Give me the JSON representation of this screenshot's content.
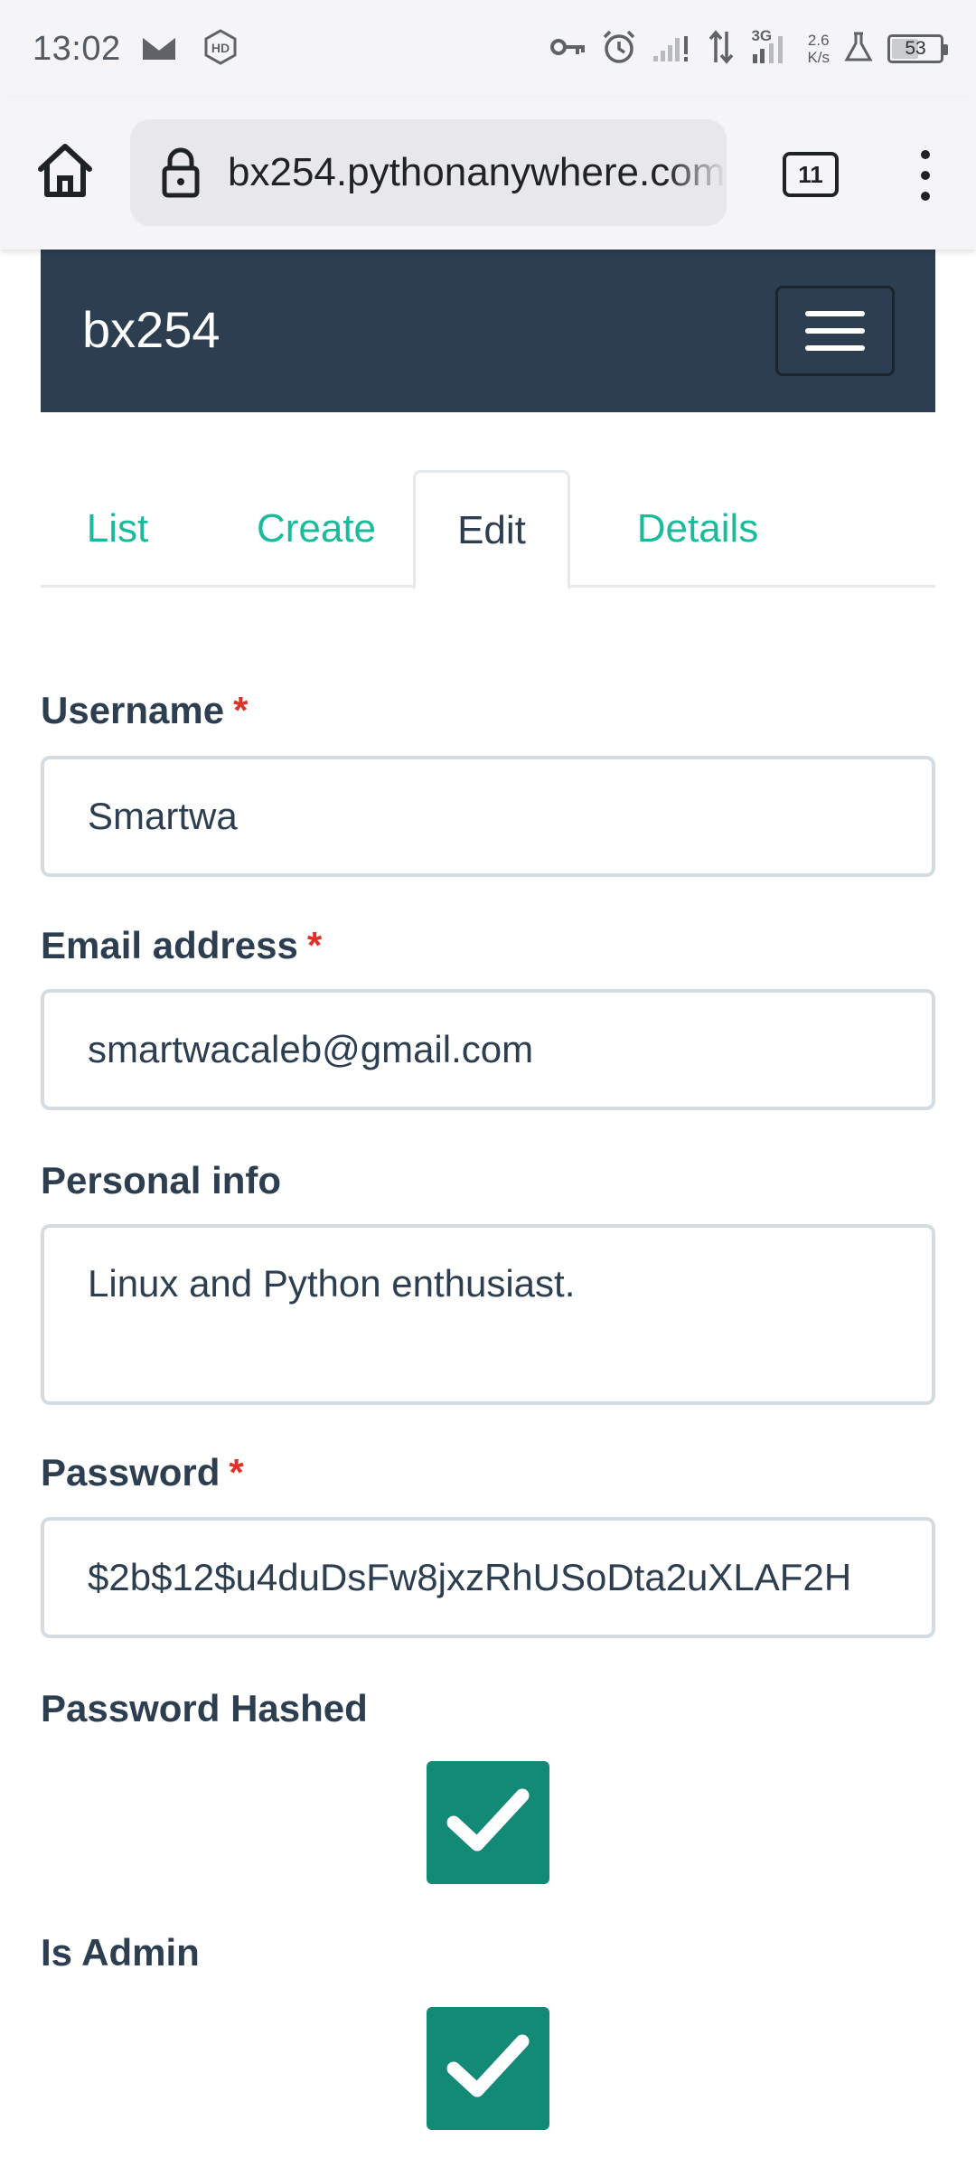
{
  "status_bar": {
    "time": "13:02",
    "speed_value": "2.6",
    "speed_unit": "K/s",
    "network_label": "3G",
    "battery": "53",
    "battery_level_percent": 53
  },
  "browser": {
    "url": "bx254.pythonanywhere.com",
    "tab_count": "11"
  },
  "navbar": {
    "brand": "bx254"
  },
  "tabs": [
    {
      "label": "List",
      "active": false
    },
    {
      "label": "Create",
      "active": false
    },
    {
      "label": "Edit",
      "active": true
    },
    {
      "label": "Details",
      "active": false
    }
  ],
  "form": {
    "username": {
      "label": "Username",
      "required_mark": "*",
      "value": "Smartwa"
    },
    "email": {
      "label": "Email address",
      "required_mark": "*",
      "value": "smartwacaleb@gmail.com"
    },
    "personal_info": {
      "label": "Personal info",
      "value": "Linux and Python enthusiast."
    },
    "password": {
      "label": "Password",
      "required_mark": "*",
      "value": "$2b$12$u4duDsFw8jxzRhUSoDta2uXLAF2H"
    },
    "password_hashed": {
      "label": "Password Hashed",
      "checked": true
    },
    "is_admin": {
      "label": "Is Admin",
      "checked": true
    }
  },
  "colors": {
    "navbar_bg": "#2c3e50",
    "tab_link": "#18bc9c",
    "checkbox_bg": "#128a76",
    "required": "#e0302a"
  }
}
